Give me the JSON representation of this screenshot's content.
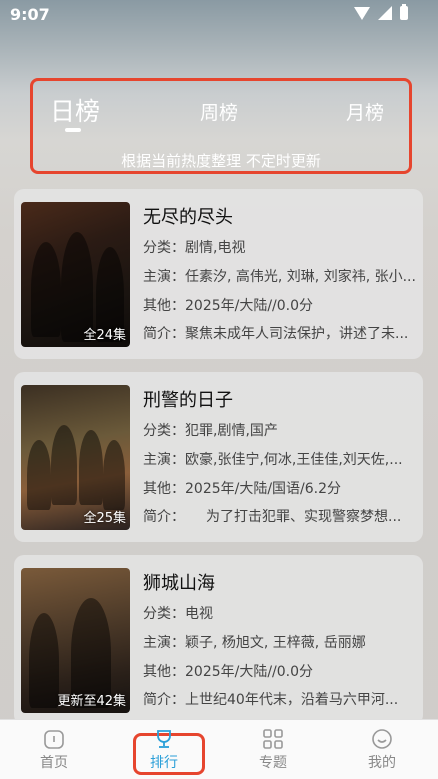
{
  "status": {
    "time": "9:07"
  },
  "tabs": {
    "day": "日榜",
    "week": "周榜",
    "month": "月榜",
    "subtitle": "根据当前热度整理 不定时更新"
  },
  "cards": [
    {
      "title": "无尽的尽头",
      "category": "分类：剧情,电视",
      "cast": "主演：任素汐, 高伟光, 刘琳, 刘家祎, 张小...",
      "other": "其他：2025年/大陆//0.0分",
      "intro": "简介：聚焦未成年人司法保护，讲述了未...",
      "episodes": "全24集"
    },
    {
      "title": "刑警的日子",
      "category": "分类：犯罪,剧情,国产",
      "cast": "主演：欧豪,张佳宁,何冰,王佳佳,刘天佐,...",
      "other": "其他：2025年/大陆/国语/6.2分",
      "intro": "简介：　　为了打击犯罪、实现警察梦想...",
      "episodes": "全25集"
    },
    {
      "title": "狮城山海",
      "category": "分类：电视",
      "cast": "主演：颖子, 杨旭文, 王梓薇, 岳丽娜",
      "other": "其他：2025年/大陆//0.0分",
      "intro": "简介：上世纪40年代末，沿着马六甲河...",
      "episodes": "更新至42集"
    }
  ],
  "tabbar": {
    "home": "首页",
    "rank": "排行",
    "topic": "专题",
    "mine": "我的"
  },
  "colors": {
    "highlight": "#e6452e",
    "active": "#2a9fd8"
  }
}
